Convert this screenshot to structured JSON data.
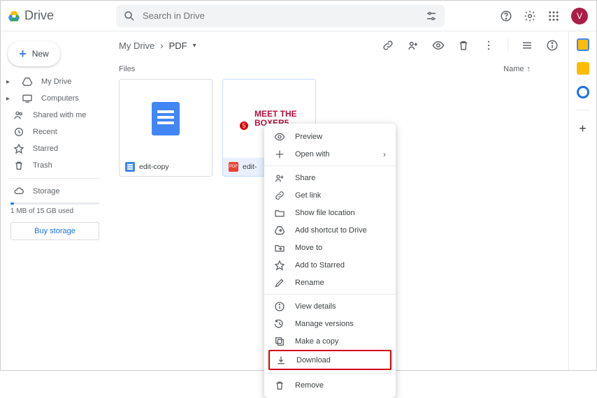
{
  "app": {
    "name": "Drive"
  },
  "search": {
    "placeholder": "Search in Drive"
  },
  "avatar": {
    "initial": "V"
  },
  "new_button": {
    "label": "New"
  },
  "sidebar": {
    "items": [
      {
        "label": "My Drive",
        "icon": "drive"
      },
      {
        "label": "Computers",
        "icon": "computer"
      },
      {
        "label": "Shared with me",
        "icon": "people"
      },
      {
        "label": "Recent",
        "icon": "clock"
      },
      {
        "label": "Starred",
        "icon": "star"
      },
      {
        "label": "Trash",
        "icon": "trash"
      }
    ],
    "storage_label": "Storage",
    "storage_used": "1 MB of 15 GB used",
    "buy_label": "Buy storage"
  },
  "breadcrumb": {
    "root": "My Drive",
    "current": "PDF"
  },
  "list_header": {
    "files": "Files",
    "name": "Name"
  },
  "files": [
    {
      "name": "edit-copy",
      "thumb_title": ""
    },
    {
      "name": "edit-",
      "thumb_title": "MEET THE BOXER5"
    }
  ],
  "context_menu": {
    "groups": [
      [
        {
          "label": "Preview",
          "icon": "eye"
        },
        {
          "label": "Open with",
          "icon": "openwith",
          "submenu": true
        }
      ],
      [
        {
          "label": "Share",
          "icon": "personadd"
        },
        {
          "label": "Get link",
          "icon": "link"
        },
        {
          "label": "Show file location",
          "icon": "folder"
        },
        {
          "label": "Add shortcut to Drive",
          "icon": "shortcut"
        },
        {
          "label": "Move to",
          "icon": "moveto"
        },
        {
          "label": "Add to Starred",
          "icon": "star"
        },
        {
          "label": "Rename",
          "icon": "rename"
        }
      ],
      [
        {
          "label": "View details",
          "icon": "info"
        },
        {
          "label": "Manage versions",
          "icon": "versions"
        },
        {
          "label": "Make a copy",
          "icon": "copy"
        },
        {
          "label": "Download",
          "icon": "download",
          "highlight": true
        }
      ],
      [
        {
          "label": "Remove",
          "icon": "trash"
        }
      ]
    ]
  }
}
